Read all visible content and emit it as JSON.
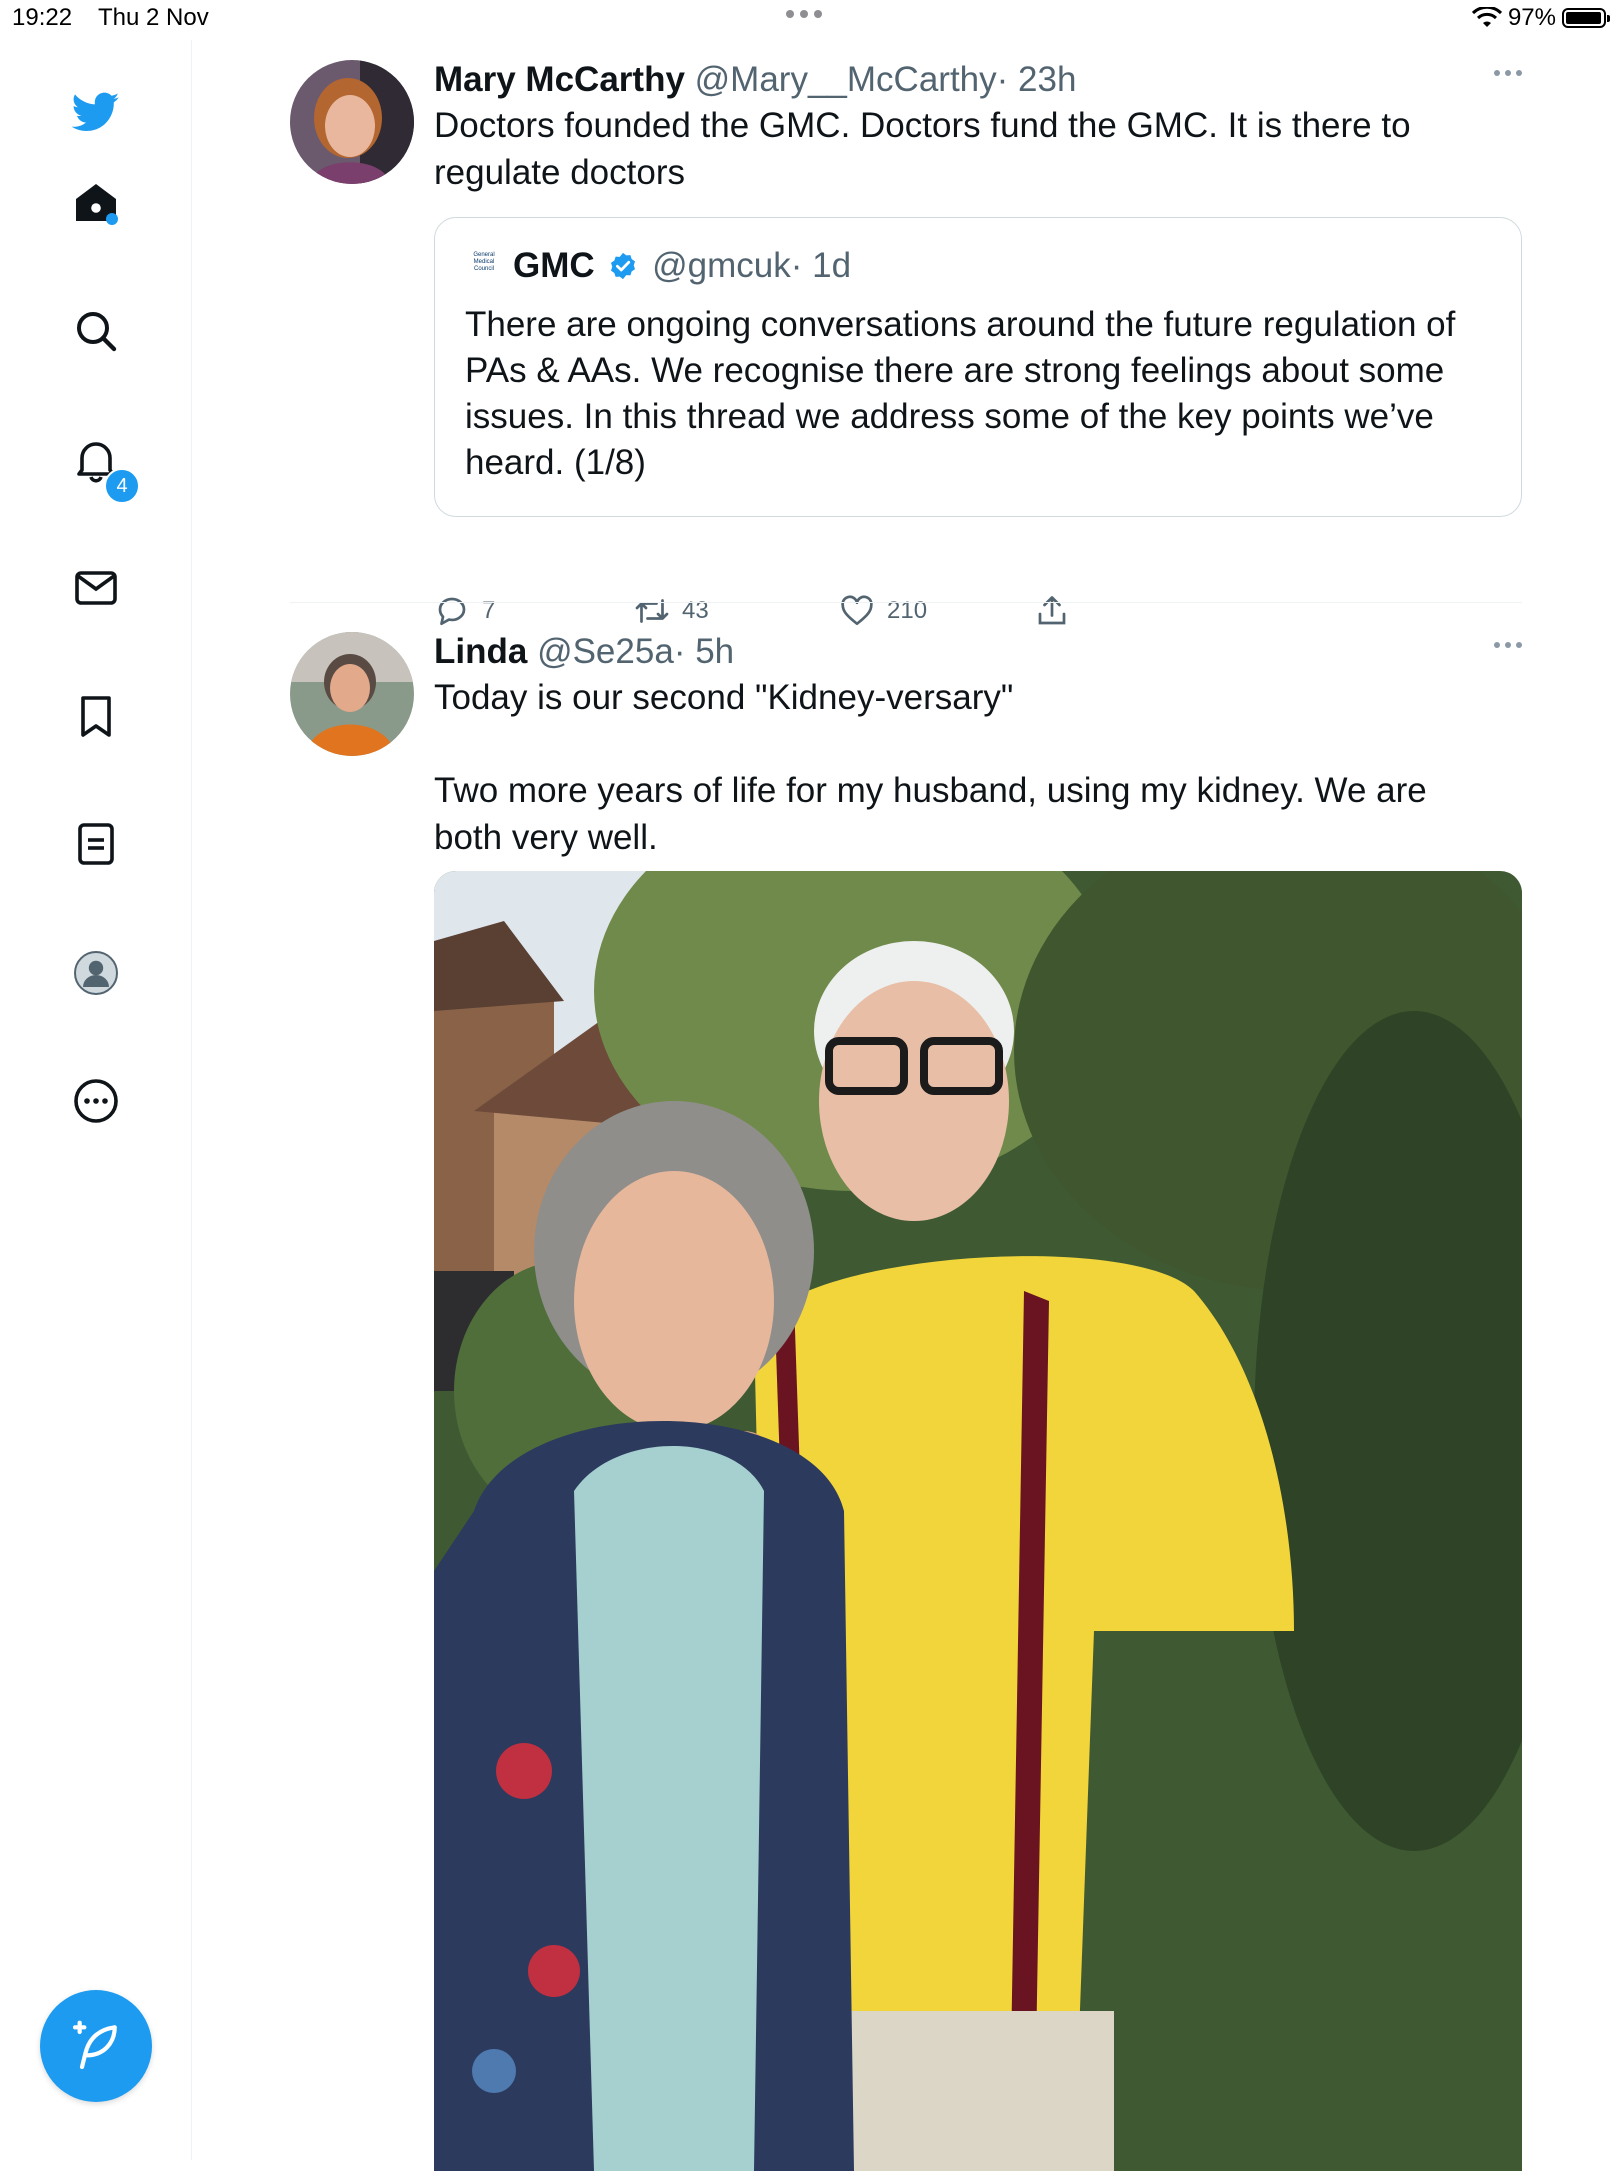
{
  "status_bar": {
    "time": "19:22",
    "date": "Thu 2 Nov",
    "battery": "97%",
    "battery_level": 0.97
  },
  "sidebar": {
    "items": [
      {
        "name": "twitter-logo"
      },
      {
        "name": "home"
      },
      {
        "name": "explore"
      },
      {
        "name": "notifications",
        "badge": "4"
      },
      {
        "name": "messages"
      },
      {
        "name": "bookmarks"
      },
      {
        "name": "lists"
      },
      {
        "name": "profile"
      },
      {
        "name": "more"
      }
    ],
    "accent_color": "#1d9bf0"
  },
  "tweets": [
    {
      "name": "Mary McCarthy",
      "handle": "@Mary__McCarthy",
      "time": "· 23h",
      "text": "Doctors founded the GMC. Doctors fund the GMC. It is there to regulate doctors",
      "quote": {
        "logo_text": [
          "General",
          "Medical",
          "Council"
        ],
        "name": "GMC",
        "handle": "@gmcuk",
        "time": "· 1d",
        "text": "There are ongoing conversations around the future regulation of PAs & AAs. We recognise there are strong feelings about some issues. In this thread we address some of the key points we’ve heard. (1/8)"
      },
      "actions": {
        "replies": "7",
        "retweets": "43",
        "likes": "210"
      }
    },
    {
      "name": "Linda",
      "handle": "@Se25a",
      "time": "· 5h",
      "text_line1": "Today is our second \"Kidney-versary\"",
      "text_line2": "Two more years of life for my husband, using my kidney. We are both very well."
    }
  ]
}
